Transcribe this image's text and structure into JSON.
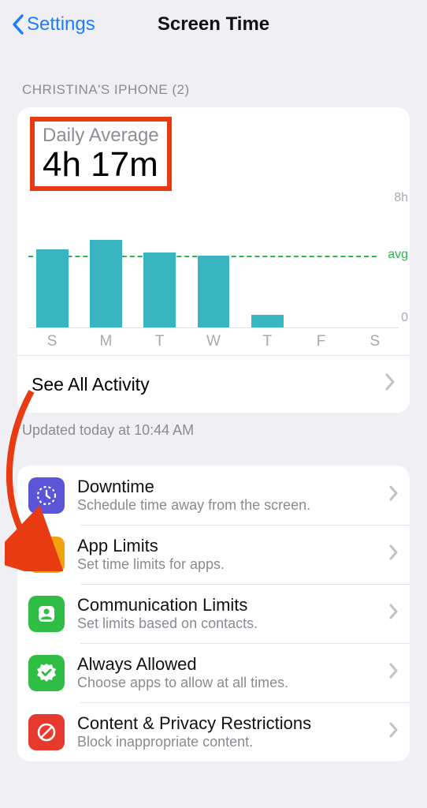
{
  "nav": {
    "back_label": "Settings",
    "title": "Screen Time"
  },
  "section_header": "CHRISTINA'S IPHONE (2)",
  "daily_average": {
    "label": "Daily Average",
    "value": "4h 17m"
  },
  "chart_data": {
    "type": "bar",
    "categories": [
      "S",
      "M",
      "T",
      "W",
      "T",
      "F",
      "S"
    ],
    "values": [
      5.0,
      5.6,
      4.8,
      4.6,
      0.8,
      0,
      0
    ],
    "ylabel_max": "8h",
    "ylabel_min": "0",
    "avg_label": "avg",
    "avg_value": 4.28,
    "ylim": [
      0,
      8
    ]
  },
  "see_all_label": "See All Activity",
  "updated_text": "Updated today at 10:44 AM",
  "settings": [
    {
      "title": "Downtime",
      "sub": "Schedule time away from the screen.",
      "icon": "downtime-icon",
      "color": "#5a55d6"
    },
    {
      "title": "App Limits",
      "sub": "Set time limits for apps.",
      "icon": "hourglass-icon",
      "color": "#f2a20c"
    },
    {
      "title": "Communication Limits",
      "sub": "Set limits based on contacts.",
      "icon": "contact-icon",
      "color": "#2fbe44"
    },
    {
      "title": "Always Allowed",
      "sub": "Choose apps to allow at all times.",
      "icon": "check-badge-icon",
      "color": "#2fbe44"
    },
    {
      "title": "Content & Privacy Restrictions",
      "sub": "Block inappropriate content.",
      "icon": "no-entry-icon",
      "color": "#e63a2e"
    }
  ],
  "annotation": {
    "highlight": "daily-average",
    "arrow_target": "app-limits"
  }
}
